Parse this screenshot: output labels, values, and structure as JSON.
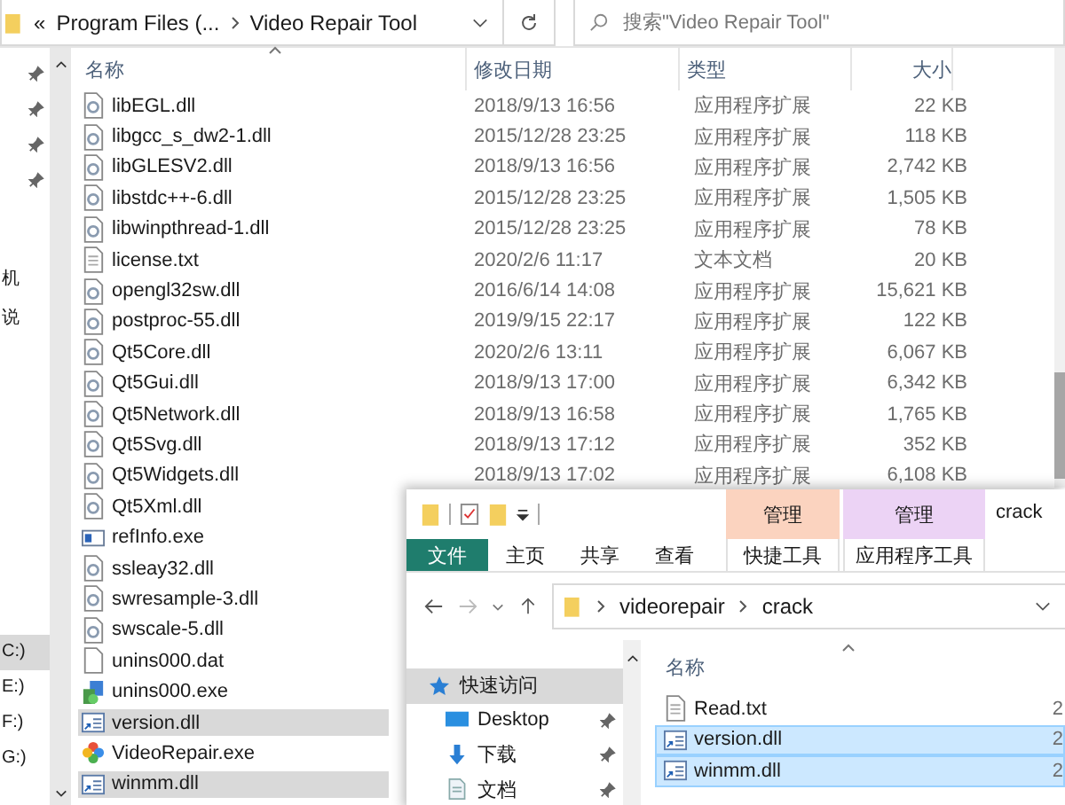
{
  "back_window": {
    "breadcrumb": {
      "overflow": "«",
      "items": [
        "Program Files (...",
        "Video Repair Tool"
      ]
    },
    "search": {
      "placeholder": "搜索\"Video Repair Tool\""
    },
    "nav_items": [
      {
        "kind": "pin"
      },
      {
        "kind": "pin"
      },
      {
        "kind": "pin"
      },
      {
        "kind": "pin"
      },
      {
        "kind": "label",
        "label": "机",
        "selected": false
      },
      {
        "kind": "label",
        "label": "说",
        "selected": false
      },
      {
        "kind": "drive",
        "label": "C:)",
        "selected": true
      },
      {
        "kind": "drive",
        "label": "E:)",
        "selected": false
      },
      {
        "kind": "drive",
        "label": "F:)",
        "selected": false
      },
      {
        "kind": "drive",
        "label": "G:)",
        "selected": false
      }
    ],
    "columns": [
      "名称",
      "修改日期",
      "类型",
      "大小"
    ],
    "files": [
      {
        "kind": "dll",
        "name": "libEGL.dll",
        "date": "2018/9/13 16:56",
        "type": "应用程序扩展",
        "size": "22 KB",
        "selected": false
      },
      {
        "kind": "dll",
        "name": "libgcc_s_dw2-1.dll",
        "date": "2015/12/28 23:25",
        "type": "应用程序扩展",
        "size": "118 KB",
        "selected": false
      },
      {
        "kind": "dll",
        "name": "libGLESV2.dll",
        "date": "2018/9/13 16:56",
        "type": "应用程序扩展",
        "size": "2,742 KB",
        "selected": false
      },
      {
        "kind": "dll",
        "name": "libstdc++-6.dll",
        "date": "2015/12/28 23:25",
        "type": "应用程序扩展",
        "size": "1,505 KB",
        "selected": false
      },
      {
        "kind": "dll",
        "name": "libwinpthread-1.dll",
        "date": "2015/12/28 23:25",
        "type": "应用程序扩展",
        "size": "78 KB",
        "selected": false
      },
      {
        "kind": "txt",
        "name": "license.txt",
        "date": "2020/2/6 11:17",
        "type": "文本文档",
        "size": "20 KB",
        "selected": false
      },
      {
        "kind": "dll",
        "name": "opengl32sw.dll",
        "date": "2016/6/14 14:08",
        "type": "应用程序扩展",
        "size": "15,621 KB",
        "selected": false
      },
      {
        "kind": "dll",
        "name": "postproc-55.dll",
        "date": "2019/9/15 22:17",
        "type": "应用程序扩展",
        "size": "122 KB",
        "selected": false
      },
      {
        "kind": "dll",
        "name": "Qt5Core.dll",
        "date": "2020/2/6 13:11",
        "type": "应用程序扩展",
        "size": "6,067 KB",
        "selected": false
      },
      {
        "kind": "dll",
        "name": "Qt5Gui.dll",
        "date": "2018/9/13 17:00",
        "type": "应用程序扩展",
        "size": "6,342 KB",
        "selected": false
      },
      {
        "kind": "dll",
        "name": "Qt5Network.dll",
        "date": "2018/9/13 16:58",
        "type": "应用程序扩展",
        "size": "1,765 KB",
        "selected": false
      },
      {
        "kind": "dll",
        "name": "Qt5Svg.dll",
        "date": "2018/9/13 17:12",
        "type": "应用程序扩展",
        "size": "352 KB",
        "selected": false
      },
      {
        "kind": "dll",
        "name": "Qt5Widgets.dll",
        "date": "2018/9/13 17:02",
        "type": "应用程序扩展",
        "size": "6,108 KB",
        "selected": false
      },
      {
        "kind": "dll",
        "name": "Qt5Xml.dll",
        "selected": false
      },
      {
        "kind": "exe-info",
        "name": "refInfo.exe",
        "selected": false
      },
      {
        "kind": "dll",
        "name": "ssleay32.dll",
        "selected": false
      },
      {
        "kind": "dll",
        "name": "swresample-3.dll",
        "selected": false
      },
      {
        "kind": "dll",
        "name": "swscale-5.dll",
        "selected": false
      },
      {
        "kind": "blank",
        "name": "unins000.dat",
        "selected": false
      },
      {
        "kind": "setup",
        "name": "unins000.exe",
        "selected": false
      },
      {
        "kind": "shortcut",
        "name": "version.dll",
        "selected": true
      },
      {
        "kind": "app",
        "name": "VideoRepair.exe",
        "selected": false
      },
      {
        "kind": "shortcut",
        "name": "winmm.dll",
        "selected": true
      }
    ]
  },
  "front_window": {
    "title": "crack",
    "ribbon_tabs": [
      {
        "kind": "file",
        "label": "文件"
      },
      {
        "kind": "tab",
        "label": "主页"
      },
      {
        "kind": "tab",
        "label": "共享"
      },
      {
        "kind": "tab",
        "label": "查看"
      }
    ],
    "context_groups": [
      {
        "header": "管理",
        "tab": "快捷工具",
        "color": "#fbd3bf"
      },
      {
        "header": "管理",
        "tab": "应用程序工具",
        "color": "#ecd3f5"
      }
    ],
    "path": [
      "videorepair",
      "crack"
    ],
    "nav_items": [
      {
        "kind": "star",
        "label": "快速访问",
        "selected": true,
        "pinned": false
      },
      {
        "kind": "desktop",
        "label": "Desktop",
        "selected": false,
        "pinned": true
      },
      {
        "kind": "download",
        "label": "下载",
        "selected": false,
        "pinned": true
      },
      {
        "kind": "doc",
        "label": "文档",
        "selected": false,
        "pinned": true
      }
    ],
    "column": "名称",
    "files": [
      {
        "kind": "txt",
        "name": "Read.txt",
        "date": "2",
        "selected": false
      },
      {
        "kind": "shortcut",
        "name": "version.dll",
        "date": "2",
        "selected": true
      },
      {
        "kind": "shortcut",
        "name": "winmm.dll",
        "date": "2",
        "selected": true
      }
    ]
  }
}
